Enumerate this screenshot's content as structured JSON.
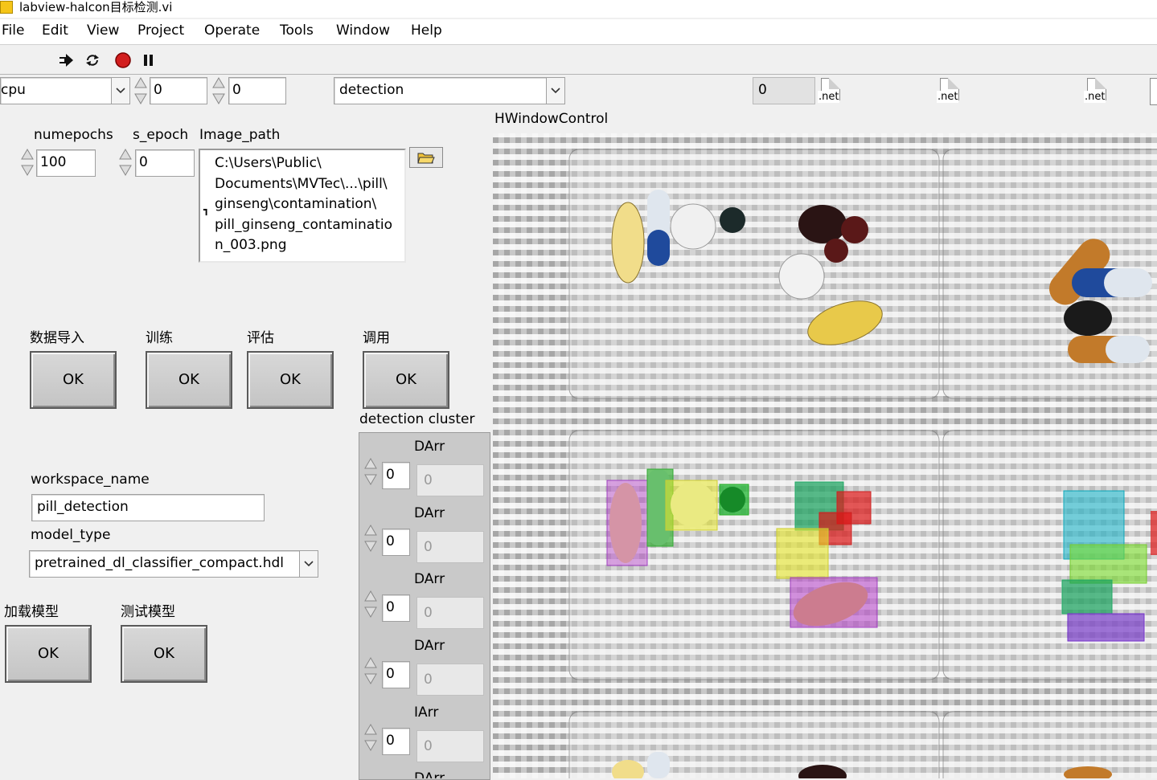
{
  "window": {
    "title": "labview-halcon目标检测.vi"
  },
  "menu": [
    "File",
    "Edit",
    "View",
    "Project",
    "Operate",
    "Tools",
    "Window",
    "Help"
  ],
  "toolbar": {
    "icons": [
      "run-arrow-icon",
      "run-continuously-icon",
      "abort-icon",
      "pause-icon"
    ]
  },
  "top_row": {
    "device": "cpu",
    "num1": "0",
    "num2": "0",
    "task": "detection",
    "num3": "0",
    "net_label": ".net"
  },
  "params": {
    "numepochs_label": "numepochs",
    "numepochs_value": "100",
    "s_epoch_label": "s_epoch",
    "s_epoch_value": "0",
    "image_path_label": "Image_path",
    "image_path_lines": [
      "C:\\Users\\Public\\",
      "Documents\\MVTec\\...\\pill\\",
      "ginseng\\contamination\\",
      "pill_ginseng_contaminatio",
      "n_003.png"
    ]
  },
  "actions": [
    {
      "label": "数据导入",
      "button": "OK"
    },
    {
      "label": "训练",
      "button": "OK"
    },
    {
      "label": "评估",
      "button": "OK"
    },
    {
      "label": "调用",
      "button": "OK"
    }
  ],
  "workspace": {
    "workspace_label": "workspace_name",
    "workspace_value": "pill_detection",
    "model_type_label": "model_type",
    "model_type_value": "pretrained_dl_classifier_compact.hdl"
  },
  "model_actions": [
    {
      "label": "加载模型",
      "button": "OK"
    },
    {
      "label": "测试模型",
      "button": "OK"
    }
  ],
  "cluster": {
    "title": "detection cluster",
    "items": [
      {
        "label": "DArr",
        "index": "0",
        "value": "0"
      },
      {
        "label": "DArr",
        "index": "0",
        "value": "0"
      },
      {
        "label": "DArr",
        "index": "0",
        "value": "0"
      },
      {
        "label": "DArr",
        "index": "0",
        "value": "0"
      },
      {
        "label": "IArr",
        "index": "0",
        "value": "0"
      }
    ],
    "last_label": "DArr"
  },
  "image_display": {
    "label": "HWindowControl"
  },
  "colors": {
    "panel": "#f0f0f0",
    "cluster": "#c9c9c9",
    "button": "#cfcfcf"
  }
}
